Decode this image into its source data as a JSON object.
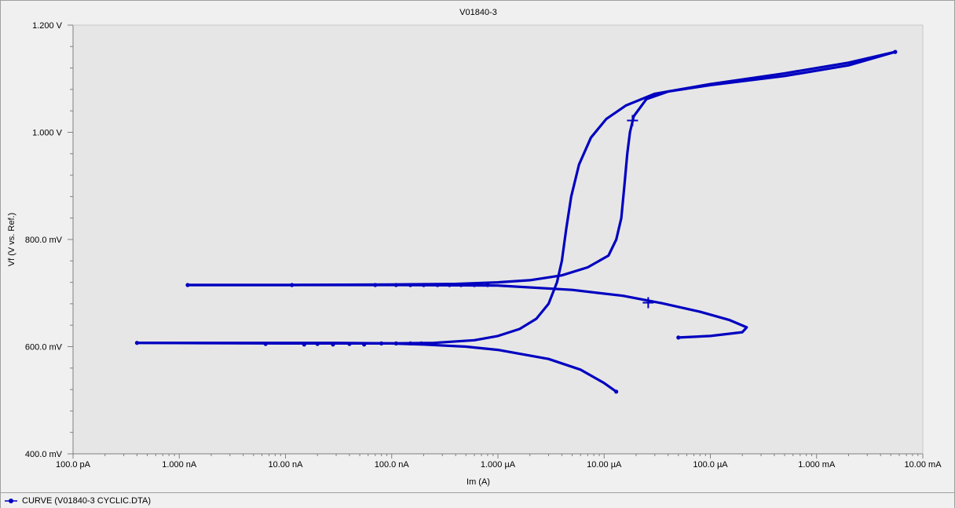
{
  "chart_data": {
    "type": "scatter",
    "title": "V01840-3",
    "xlabel": "Im (A)",
    "ylabel": "Vf (V vs. Ref.)",
    "xscale": "log",
    "xlim": [
      1e-10,
      0.01
    ],
    "ylim": [
      0.4,
      1.2
    ],
    "x_ticks": [
      {
        "value": 1e-10,
        "label": "100.0 pA"
      },
      {
        "value": 1e-09,
        "label": "1.000 nA"
      },
      {
        "value": 1e-08,
        "label": "10.00 nA"
      },
      {
        "value": 1e-07,
        "label": "100.0 nA"
      },
      {
        "value": 1e-06,
        "label": "1.000 µA"
      },
      {
        "value": 1e-05,
        "label": "10.00 µA"
      },
      {
        "value": 0.0001,
        "label": "100.0 µA"
      },
      {
        "value": 0.001,
        "label": "1.000 mA"
      },
      {
        "value": 0.01,
        "label": "10.00 mA"
      }
    ],
    "y_ticks": [
      {
        "value": 0.4,
        "label": "400.0 mV"
      },
      {
        "value": 0.6,
        "label": "600.0 mV"
      },
      {
        "value": 0.8,
        "label": "800.0 mV"
      },
      {
        "value": 1.0,
        "label": "1.000 V"
      },
      {
        "value": 1.2,
        "label": "1.200 V"
      }
    ],
    "grid": false,
    "legend_position": "bottom-left",
    "colors": {
      "series": "#0000c0",
      "plot_bg": "#e6e6e6",
      "axis": "#808080"
    },
    "series": [
      {
        "name": "CURVE (V01840-3 CYCLIC.DTA)",
        "segments": [
          {
            "points": [
              [
                1.3e-05,
                0.516
              ],
              [
                1e-05,
                0.532
              ],
              [
                6e-06,
                0.557
              ],
              [
                3e-06,
                0.577
              ],
              [
                1e-06,
                0.594
              ],
              [
                5e-07,
                0.6
              ],
              [
                2e-07,
                0.604
              ],
              [
                1e-07,
                0.606
              ],
              [
                3e-08,
                0.607
              ],
              [
                1e-08,
                0.607
              ],
              [
                1e-09,
                0.607
              ],
              [
                4e-10,
                0.607
              ]
            ]
          },
          {
            "points": [
              [
                4e-10,
                0.607
              ],
              [
                1e-08,
                0.606
              ],
              [
                1e-07,
                0.606
              ],
              [
                2.5e-07,
                0.607
              ],
              [
                6e-07,
                0.612
              ],
              [
                1e-06,
                0.62
              ],
              [
                1.6e-06,
                0.633
              ],
              [
                2.3e-06,
                0.652
              ],
              [
                3e-06,
                0.68
              ],
              [
                3.6e-06,
                0.72
              ],
              [
                4e-06,
                0.76
              ],
              [
                4.4e-06,
                0.82
              ],
              [
                4.9e-06,
                0.88
              ],
              [
                5.8e-06,
                0.94
              ],
              [
                7.5e-06,
                0.99
              ],
              [
                1.05e-05,
                1.025
              ],
              [
                1.6e-05,
                1.05
              ],
              [
                3e-05,
                1.072
              ],
              [
                0.0001,
                1.09
              ],
              [
                0.0005,
                1.11
              ],
              [
                0.002,
                1.13
              ],
              [
                0.0055,
                1.15
              ]
            ]
          },
          {
            "points": [
              [
                0.0055,
                1.15
              ],
              [
                0.002,
                1.125
              ],
              [
                0.0005,
                1.105
              ],
              [
                0.0001,
                1.088
              ],
              [
                4e-05,
                1.076
              ],
              [
                2.5e-05,
                1.062
              ],
              [
                1.9e-05,
                1.03
              ],
              [
                1.75e-05,
                1.0
              ],
              [
                1.65e-05,
                0.96
              ],
              [
                1.55e-05,
                0.9
              ],
              [
                1.45e-05,
                0.84
              ],
              [
                1.3e-05,
                0.8
              ],
              [
                1.1e-05,
                0.77
              ],
              [
                7e-06,
                0.748
              ],
              [
                4e-06,
                0.733
              ],
              [
                2e-06,
                0.724
              ],
              [
                1e-06,
                0.72
              ],
              [
                4e-07,
                0.717
              ],
              [
                1e-07,
                0.716
              ],
              [
                1e-08,
                0.715
              ],
              [
                1.2e-09,
                0.715
              ]
            ]
          },
          {
            "points": [
              [
                1.2e-09,
                0.715
              ],
              [
                1e-07,
                0.715
              ],
              [
                1e-06,
                0.714
              ],
              [
                5e-06,
                0.706
              ],
              [
                1.5e-05,
                0.695
              ],
              [
                3.5e-05,
                0.681
              ],
              [
                8e-05,
                0.665
              ],
              [
                0.00015,
                0.65
              ],
              [
                0.00022,
                0.636
              ],
              [
                0.0002,
                0.627
              ],
              [
                0.0001,
                0.62
              ],
              [
                5e-05,
                0.617
              ]
            ]
          }
        ],
        "marker_points": [
          [
            4e-10,
            0.607
          ],
          [
            6.5e-09,
            0.605
          ],
          [
            1.5e-08,
            0.604
          ],
          [
            2e-08,
            0.605
          ],
          [
            2.8e-08,
            0.604
          ],
          [
            4e-08,
            0.605
          ],
          [
            5.5e-08,
            0.604
          ],
          [
            8e-08,
            0.606
          ],
          [
            1.1e-07,
            0.606
          ],
          [
            1.5e-07,
            0.606
          ],
          [
            1.9e-07,
            0.606
          ],
          [
            1.2e-09,
            0.715
          ],
          [
            1.15e-08,
            0.715
          ],
          [
            7e-08,
            0.715
          ],
          [
            1.1e-07,
            0.715
          ],
          [
            1.5e-07,
            0.715
          ],
          [
            2e-07,
            0.715
          ],
          [
            2.7e-07,
            0.715
          ],
          [
            3.5e-07,
            0.715
          ],
          [
            4.5e-07,
            0.715
          ],
          [
            6e-07,
            0.715
          ],
          [
            8e-07,
            0.715
          ],
          [
            1.3e-05,
            0.516
          ],
          [
            0.0055,
            1.15
          ],
          [
            5e-05,
            0.617
          ]
        ],
        "cross_markers": [
          [
            1.85e-05,
            1.022
          ],
          [
            2.6e-05,
            0.682
          ]
        ]
      }
    ]
  }
}
